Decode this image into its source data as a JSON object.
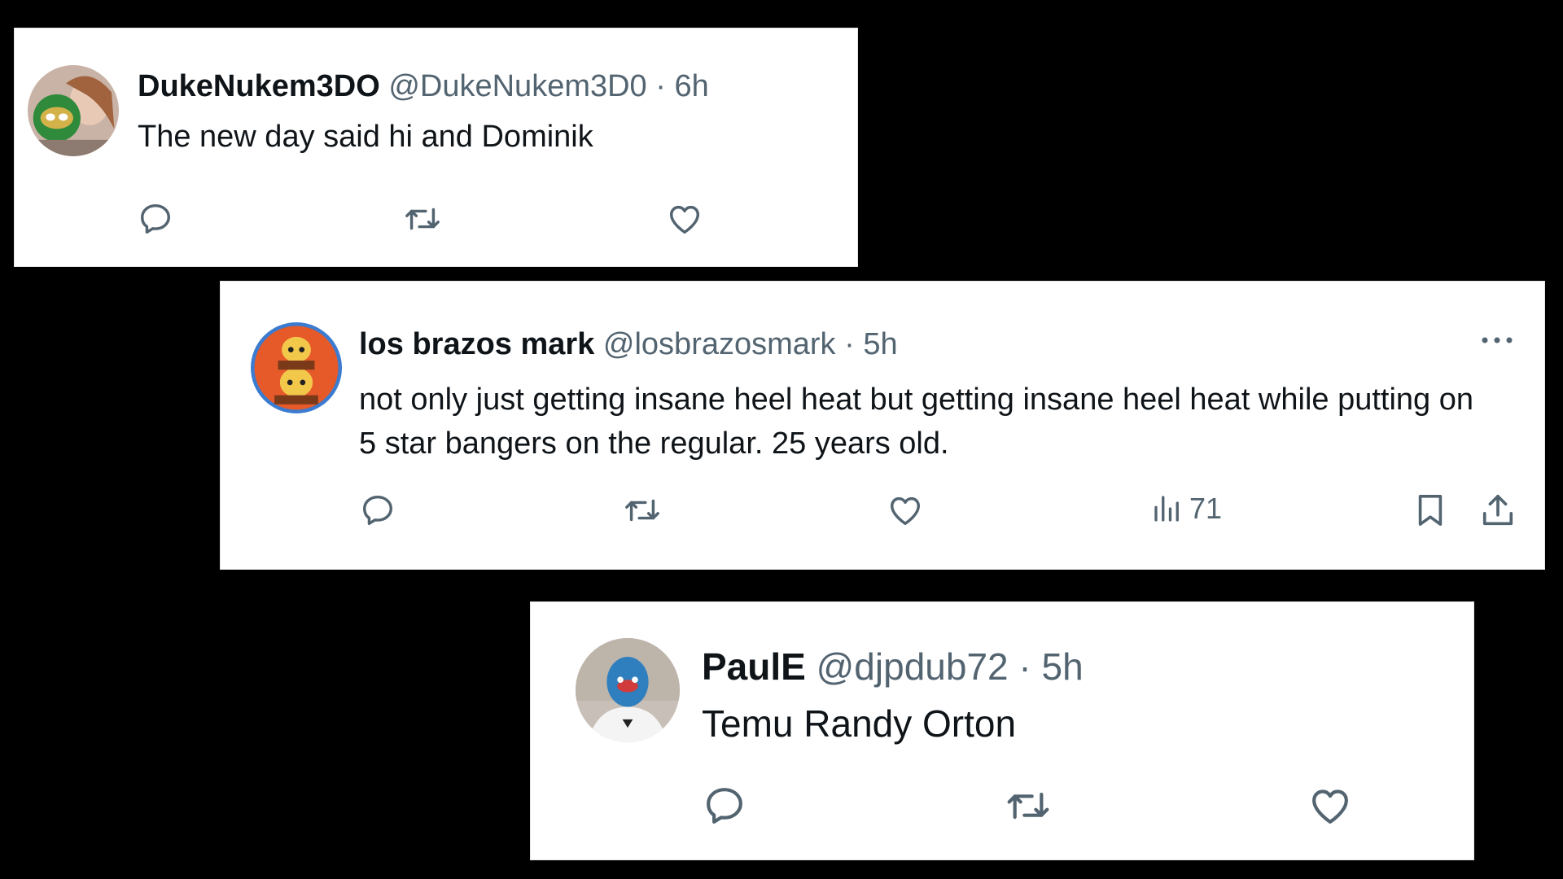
{
  "tweets": [
    {
      "name": "DukeNukem3DO",
      "handle": "@DukeNukem3D0",
      "separator": "·",
      "time": "6h",
      "text": "The new day said hi and Dominik",
      "actions": [
        "reply-icon",
        "retweet-icon",
        "like-icon"
      ]
    },
    {
      "name": "los brazos mark",
      "handle": "@losbrazosmark",
      "separator": "·",
      "time": "5h",
      "text": "not only just getting insane heel heat but getting insane heel heat while putting on 5 star bangers on the regular. 25 years old.",
      "views": "71",
      "actions": [
        "reply-icon",
        "retweet-icon",
        "like-icon",
        "views-icon",
        "bookmark-icon",
        "share-icon",
        "more-icon"
      ]
    },
    {
      "name": "PaulE",
      "handle": "@djpdub72",
      "separator": "·",
      "time": "5h",
      "text": "Temu Randy Orton",
      "actions": [
        "reply-icon",
        "retweet-icon",
        "like-icon"
      ]
    }
  ],
  "colors": {
    "background": "#000000",
    "card": "#ffffff",
    "text": "#0f1419",
    "secondary": "#536471"
  }
}
